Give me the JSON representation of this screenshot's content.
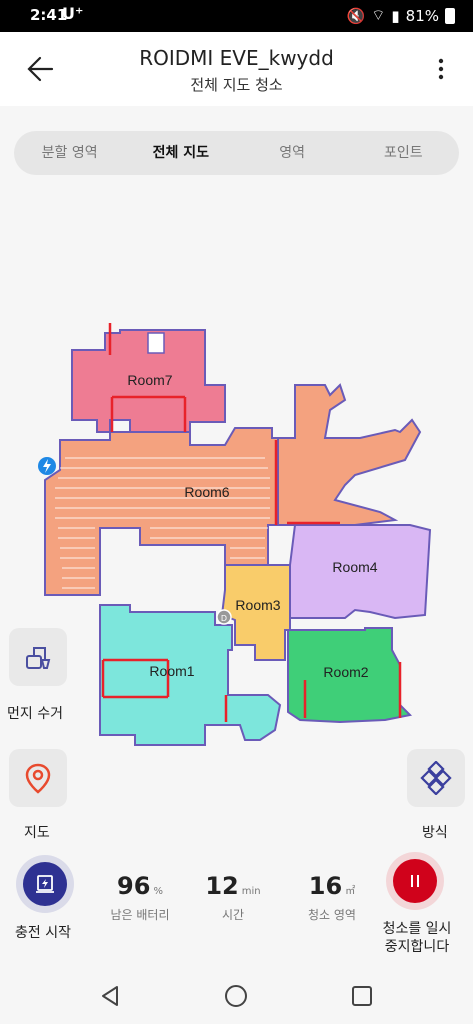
{
  "status": {
    "time": "2:41",
    "carrier": "U⁺",
    "battery": "81%"
  },
  "header": {
    "title": "ROIDMI EVE_kwydd",
    "subtitle": "전체 지도 청소"
  },
  "tabs": [
    {
      "label": "분할 영역"
    },
    {
      "label": "전체 지도"
    },
    {
      "label": "영역"
    },
    {
      "label": "포인트"
    }
  ],
  "map": {
    "rooms": [
      {
        "name": "Room7",
        "color": "#ee7c93"
      },
      {
        "name": "Room6",
        "color": "#f4a27f"
      },
      {
        "name": "Room4",
        "color": "#d9b7f4"
      },
      {
        "name": "Room3",
        "color": "#f9cc6a"
      },
      {
        "name": "Room1",
        "color": "#7de6dc"
      },
      {
        "name": "Room2",
        "color": "#3fcf78"
      }
    ],
    "dock_label": "D"
  },
  "actions": {
    "dust": {
      "label": "먼지 수거",
      "icon": "dust-collector-icon"
    },
    "map": {
      "label": "지도",
      "icon": "location-pin-icon"
    },
    "mode": {
      "label": "방식",
      "icon": "mode-pattern-icon"
    }
  },
  "bottom": {
    "charge": {
      "label": "충전 시작",
      "icon": "charge-station-icon",
      "color": "#2e3192"
    },
    "battery": {
      "value": "96",
      "unit": "%",
      "label": "남은 배터리"
    },
    "time": {
      "value": "12",
      "unit": "min",
      "label": "시간"
    },
    "area": {
      "value": "16",
      "unit": "㎡",
      "label": "청소 영역"
    },
    "pause": {
      "label_line1": "청소를 일시",
      "label_line2": "중지합니다",
      "icon": "pause-icon",
      "color": "#d0021b"
    }
  }
}
